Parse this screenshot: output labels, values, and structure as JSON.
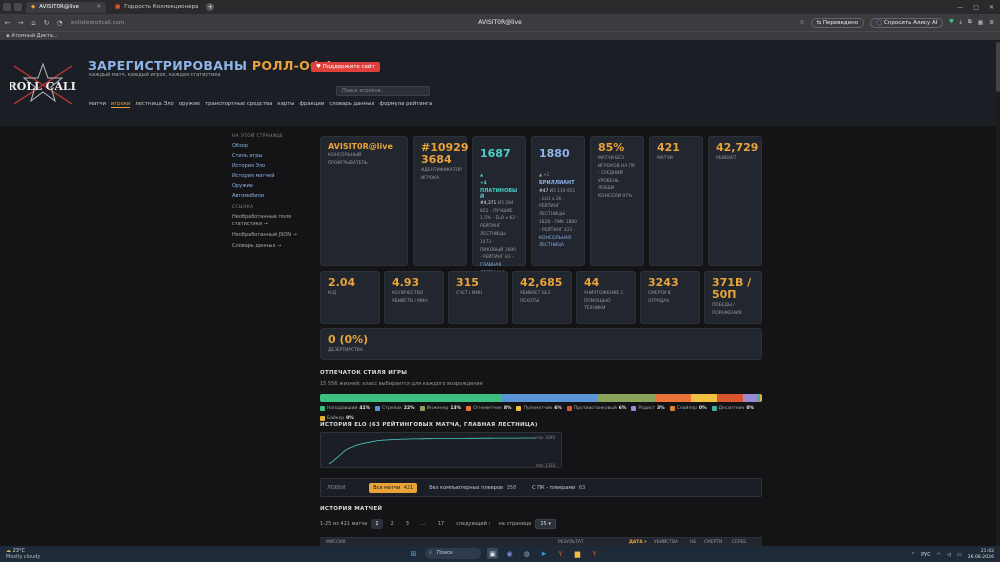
{
  "browser": {
    "tabs": [
      {
        "label": "AVISIT0R@live",
        "favicon": "rc",
        "active": true
      },
      {
        "label": "Гордость Коллекционера",
        "favicon": "game",
        "active": false
      }
    ],
    "url": "enlistedrollcall.com",
    "page_title": "AVISIT0R@live",
    "translated_label": "Переведено",
    "alice_label": "Спросить Алису AI",
    "bookmark": "Атомный Дикта..."
  },
  "header": {
    "logo_text": "ROLL CALL",
    "title_part1": "ЗАРЕГИСТРИРОВАНЫ",
    "title_part2": "РОЛЛ-ОФФ",
    "tagline": "каждый матч, каждый игрок, каждая статистика",
    "support_button": "♥ Поддержите сайт",
    "search_placeholder": "Поиск игроков...",
    "nav": [
      {
        "label": "матчи",
        "active": false
      },
      {
        "label": "игроки",
        "active": true
      },
      {
        "label": "лестница Эло",
        "active": false
      },
      {
        "label": "оружие",
        "active": false
      },
      {
        "label": "транспортные средства",
        "active": false
      },
      {
        "label": "карты",
        "active": false
      },
      {
        "label": "фракции",
        "active": false
      },
      {
        "label": "словарь данных",
        "active": false
      },
      {
        "label": "формула рейтинга",
        "active": false
      }
    ]
  },
  "sidebar": {
    "on_page_heading": "НА ЭТОЙ СТРАНИЦЕ",
    "on_page": [
      "Обзор",
      "Стиль игры",
      "История Эло",
      "История матчей",
      "Оружие",
      "Автомобили"
    ],
    "links_heading": "ССЫЛКА",
    "links": [
      "Необработанные поля статистики →",
      "Необработанный JSON →",
      "Словарь данных →"
    ]
  },
  "player_card": {
    "name": "AVISIT0R@live",
    "platform": "КОНСОЛЬНЫЙ ПРОИГРЫВАТЕЛЬ"
  },
  "id_card": {
    "value": "#10929 3684",
    "label": "ИДЕНТИФИКАТОР ИГРОКА"
  },
  "rating_card": {
    "value": "1687",
    "arrow": "▲",
    "delta": "+4",
    "tier": "ПЛАТИНОВЫ Й",
    "rank": "#4,371",
    "details": "ИЗ 284 822 - ЛУЧШИЕ 1,5% - ELO x 62 - РЕЙТИНГ ЛЕСТНИЦЫ 1473 - ПИКОВЫЙ 1690 - РЕЙТИНГ 83 -",
    "link": "ГЛАВНАЯ ЛЕСТНИЦА"
  },
  "console_card": {
    "value": "1880",
    "delta": "▲ +1",
    "tier": "БРИЛЛИАНТ",
    "rank": "#47",
    "details": "ИЗ 119 851 - ELO x 26 - РЕЙТИНГ ЛЕСТНИЦЫ 1828 - ПИК 1880 - РЕЙТИНГ 421 -",
    "link": "КОНСОЛЬНАЯ ЛЕСТНИЦА"
  },
  "pct_card": {
    "value": "85%",
    "label": "МАТЧИ БЕЗ ИГРОКОВ НА ПК - СРЕДНИЙ УРОВЕНЬ ЛОББИ КОНСОЛИ 97%"
  },
  "matches_card": {
    "value": "421",
    "label": "МАТЧИ"
  },
  "kills_card": {
    "value": "42,729",
    "label": "УБИВАЕТ"
  },
  "stats_row2": [
    {
      "value": "2.04",
      "label": "К/Д"
    },
    {
      "value": "4.93",
      "label": "КОЛИЧЕСТВО УБИЙСТВ / МИН"
    },
    {
      "value": "315",
      "label": "СЧЕТ / МИН"
    },
    {
      "value": "42,685",
      "label": "УБИВАЕТ БЕЗ ПЕХОТЫ"
    },
    {
      "value": "44",
      "label": "УНИЧТОЖЕНИЕ С ПОМОЩЬЮ ТЕХНИКИ"
    },
    {
      "value": "3243",
      "label": "СМЕРТИ В ОТРЯДАХ"
    },
    {
      "value": "371В / 50П",
      "label": "ПОБЕДЫ / ПОРАЖЕНИЯ"
    }
  ],
  "desertion_card": {
    "value": "0 (0%)",
    "label": "ДЕЗЕРТИРСТВА"
  },
  "playstyle": {
    "title": "ОТПЕЧАТОК СТИЛЯ ИГРЫ",
    "subtitle": "15 556 жизней; класс выбирается для каждого возрождения",
    "segments": [
      {
        "name": "Нападавший",
        "pct": "41%",
        "share": 41,
        "color": "#3dbf7f"
      },
      {
        "name": "Стрелок",
        "pct": "22%",
        "share": 22,
        "color": "#5b95d6"
      },
      {
        "name": "Инженер",
        "pct": "13%",
        "share": 13,
        "color": "#8aa35a"
      },
      {
        "name": "Огнеметчик",
        "pct": "8%",
        "share": 8,
        "color": "#e8743a"
      },
      {
        "name": "Пулеметчик",
        "pct": "6%",
        "share": 6,
        "color": "#f0c040"
      },
      {
        "name": "Противотанковый",
        "pct": "6%",
        "share": 6,
        "color": "#d9552e"
      },
      {
        "name": "Радист",
        "pct": "3%",
        "share": 3,
        "color": "#9a8ad6"
      },
      {
        "name": "Снайпер",
        "pct": "0%",
        "share": 0.4,
        "color": "#e08030"
      },
      {
        "name": "Десантник",
        "pct": "0%",
        "share": 0.4,
        "color": "#40b0a0"
      },
      {
        "name": "Байкер",
        "pct": "0%",
        "share": 0.4,
        "color": "#e0b030"
      }
    ]
  },
  "elo_history": {
    "title": "ИСТОРИЯ ELO (63 РЕЙТИНГОВЫХ МАТЧА, ГЛАВНАЯ ЛЕСТНИЦА)",
    "max_label": "max 1690",
    "min_label": "min 1328",
    "line_color": "#4dd0c8"
  },
  "chart_data": {
    "type": "line",
    "title": "ИСТОРИЯ ELO (63 РЕЙТИНГОВЫХ МАТЧА, ГЛАВНАЯ ЛЕСТНИЦА)",
    "xlabel": "",
    "ylabel": "",
    "ylim": [
      1328,
      1690
    ],
    "series": [
      {
        "values": [
          1328,
          1360,
          1400,
          1440,
          1480,
          1520,
          1545,
          1565,
          1585,
          1600,
          1610,
          1620,
          1630,
          1640,
          1648,
          1655,
          1660,
          1662,
          1665,
          1668,
          1670,
          1672,
          1674,
          1675,
          1676,
          1677,
          1678,
          1678,
          1679,
          1680,
          1680,
          1681,
          1682,
          1682,
          1683,
          1683,
          1684,
          1684,
          1684,
          1685,
          1685,
          1685,
          1686,
          1686,
          1686,
          1686,
          1687,
          1687,
          1687,
          1687,
          1688,
          1688,
          1688,
          1688,
          1689,
          1689,
          1689,
          1689,
          1690,
          1690,
          1690,
          1690,
          1687
        ]
      }
    ]
  },
  "filters": {
    "label": "ЛОББИ",
    "chips": [
      {
        "label": "Все матчи",
        "count": "421",
        "active": true
      },
      {
        "label": "Без компьютерных плееров",
        "count": "358",
        "active": false
      },
      {
        "label": "С ПК - плеерами",
        "count": "63",
        "active": false
      }
    ]
  },
  "match_history": {
    "title": "ИСТОРИЯ МАТЧЕЙ",
    "range": "1-25 из 421 матча",
    "pages": [
      "1",
      "2",
      "3",
      "...",
      "17"
    ],
    "next": "следующий ›",
    "per_page_label": "на странице",
    "per_page": "25",
    "columns": [
      "МИССИЯ",
      "РЕЗУЛЬТАТ",
      "ДАТА ▾",
      "УБИЙСТВА",
      "НБ",
      "СМЕРТИ",
      "СЕРЕБ"
    ]
  },
  "taskbar": {
    "temp": "23°C",
    "weather": "Mostly cloudy",
    "search": "Поиск",
    "lang": "РУС",
    "time": "21:42",
    "date": "26.08.2026"
  }
}
